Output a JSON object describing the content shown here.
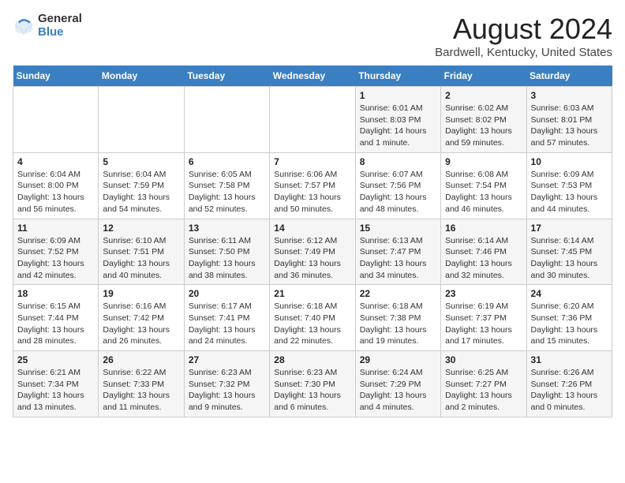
{
  "header": {
    "logo_general": "General",
    "logo_blue": "Blue",
    "main_title": "August 2024",
    "subtitle": "Bardwell, Kentucky, United States"
  },
  "weekdays": [
    "Sunday",
    "Monday",
    "Tuesday",
    "Wednesday",
    "Thursday",
    "Friday",
    "Saturday"
  ],
  "weeks": [
    [
      {
        "num": "",
        "detail": ""
      },
      {
        "num": "",
        "detail": ""
      },
      {
        "num": "",
        "detail": ""
      },
      {
        "num": "",
        "detail": ""
      },
      {
        "num": "1",
        "detail": "Sunrise: 6:01 AM\nSunset: 8:03 PM\nDaylight: 14 hours\nand 1 minute."
      },
      {
        "num": "2",
        "detail": "Sunrise: 6:02 AM\nSunset: 8:02 PM\nDaylight: 13 hours\nand 59 minutes."
      },
      {
        "num": "3",
        "detail": "Sunrise: 6:03 AM\nSunset: 8:01 PM\nDaylight: 13 hours\nand 57 minutes."
      }
    ],
    [
      {
        "num": "4",
        "detail": "Sunrise: 6:04 AM\nSunset: 8:00 PM\nDaylight: 13 hours\nand 56 minutes."
      },
      {
        "num": "5",
        "detail": "Sunrise: 6:04 AM\nSunset: 7:59 PM\nDaylight: 13 hours\nand 54 minutes."
      },
      {
        "num": "6",
        "detail": "Sunrise: 6:05 AM\nSunset: 7:58 PM\nDaylight: 13 hours\nand 52 minutes."
      },
      {
        "num": "7",
        "detail": "Sunrise: 6:06 AM\nSunset: 7:57 PM\nDaylight: 13 hours\nand 50 minutes."
      },
      {
        "num": "8",
        "detail": "Sunrise: 6:07 AM\nSunset: 7:56 PM\nDaylight: 13 hours\nand 48 minutes."
      },
      {
        "num": "9",
        "detail": "Sunrise: 6:08 AM\nSunset: 7:54 PM\nDaylight: 13 hours\nand 46 minutes."
      },
      {
        "num": "10",
        "detail": "Sunrise: 6:09 AM\nSunset: 7:53 PM\nDaylight: 13 hours\nand 44 minutes."
      }
    ],
    [
      {
        "num": "11",
        "detail": "Sunrise: 6:09 AM\nSunset: 7:52 PM\nDaylight: 13 hours\nand 42 minutes."
      },
      {
        "num": "12",
        "detail": "Sunrise: 6:10 AM\nSunset: 7:51 PM\nDaylight: 13 hours\nand 40 minutes."
      },
      {
        "num": "13",
        "detail": "Sunrise: 6:11 AM\nSunset: 7:50 PM\nDaylight: 13 hours\nand 38 minutes."
      },
      {
        "num": "14",
        "detail": "Sunrise: 6:12 AM\nSunset: 7:49 PM\nDaylight: 13 hours\nand 36 minutes."
      },
      {
        "num": "15",
        "detail": "Sunrise: 6:13 AM\nSunset: 7:47 PM\nDaylight: 13 hours\nand 34 minutes."
      },
      {
        "num": "16",
        "detail": "Sunrise: 6:14 AM\nSunset: 7:46 PM\nDaylight: 13 hours\nand 32 minutes."
      },
      {
        "num": "17",
        "detail": "Sunrise: 6:14 AM\nSunset: 7:45 PM\nDaylight: 13 hours\nand 30 minutes."
      }
    ],
    [
      {
        "num": "18",
        "detail": "Sunrise: 6:15 AM\nSunset: 7:44 PM\nDaylight: 13 hours\nand 28 minutes."
      },
      {
        "num": "19",
        "detail": "Sunrise: 6:16 AM\nSunset: 7:42 PM\nDaylight: 13 hours\nand 26 minutes."
      },
      {
        "num": "20",
        "detail": "Sunrise: 6:17 AM\nSunset: 7:41 PM\nDaylight: 13 hours\nand 24 minutes."
      },
      {
        "num": "21",
        "detail": "Sunrise: 6:18 AM\nSunset: 7:40 PM\nDaylight: 13 hours\nand 22 minutes."
      },
      {
        "num": "22",
        "detail": "Sunrise: 6:18 AM\nSunset: 7:38 PM\nDaylight: 13 hours\nand 19 minutes."
      },
      {
        "num": "23",
        "detail": "Sunrise: 6:19 AM\nSunset: 7:37 PM\nDaylight: 13 hours\nand 17 minutes."
      },
      {
        "num": "24",
        "detail": "Sunrise: 6:20 AM\nSunset: 7:36 PM\nDaylight: 13 hours\nand 15 minutes."
      }
    ],
    [
      {
        "num": "25",
        "detail": "Sunrise: 6:21 AM\nSunset: 7:34 PM\nDaylight: 13 hours\nand 13 minutes."
      },
      {
        "num": "26",
        "detail": "Sunrise: 6:22 AM\nSunset: 7:33 PM\nDaylight: 13 hours\nand 11 minutes."
      },
      {
        "num": "27",
        "detail": "Sunrise: 6:23 AM\nSunset: 7:32 PM\nDaylight: 13 hours\nand 9 minutes."
      },
      {
        "num": "28",
        "detail": "Sunrise: 6:23 AM\nSunset: 7:30 PM\nDaylight: 13 hours\nand 6 minutes."
      },
      {
        "num": "29",
        "detail": "Sunrise: 6:24 AM\nSunset: 7:29 PM\nDaylight: 13 hours\nand 4 minutes."
      },
      {
        "num": "30",
        "detail": "Sunrise: 6:25 AM\nSunset: 7:27 PM\nDaylight: 13 hours\nand 2 minutes."
      },
      {
        "num": "31",
        "detail": "Sunrise: 6:26 AM\nSunset: 7:26 PM\nDaylight: 13 hours\nand 0 minutes."
      }
    ]
  ]
}
